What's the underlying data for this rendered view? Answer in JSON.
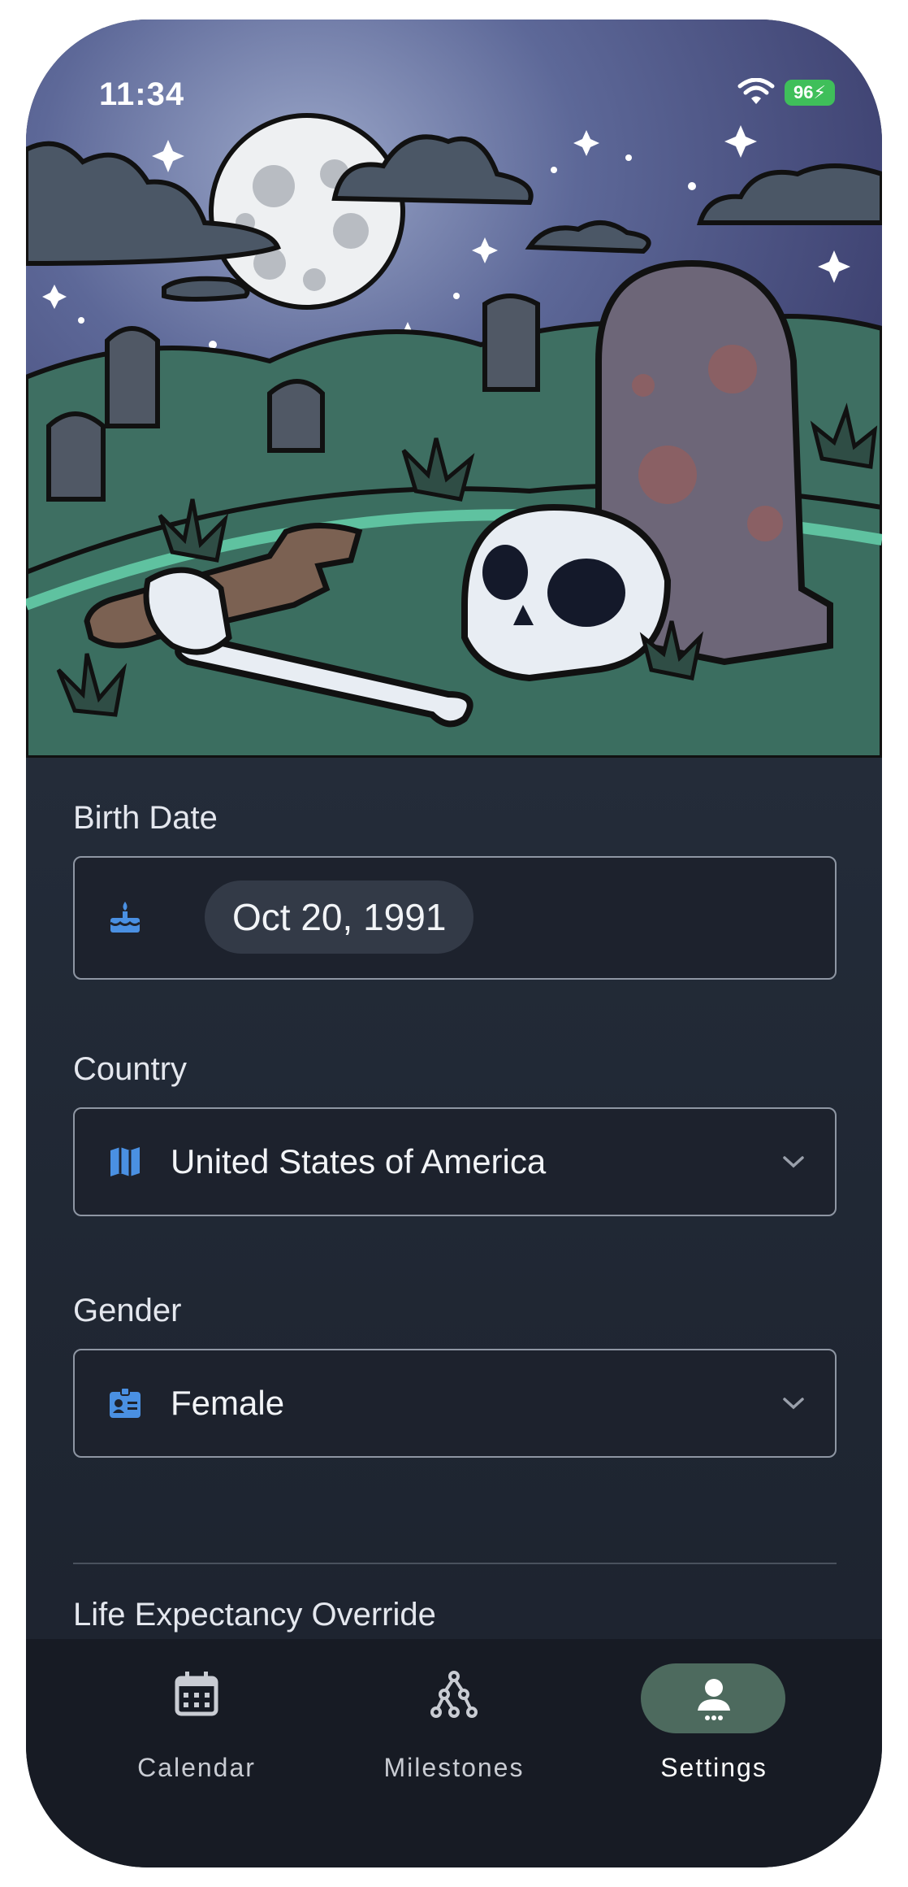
{
  "status": {
    "time": "11:34",
    "battery": "96"
  },
  "form": {
    "birth_date": {
      "label": "Birth Date",
      "value": "Oct 20, 1991"
    },
    "country": {
      "label": "Country",
      "value": "United States of America"
    },
    "gender": {
      "label": "Gender",
      "value": "Female"
    },
    "override_label": "Life Expectancy Override"
  },
  "nav": {
    "items": [
      {
        "label": "Calendar",
        "icon": "calendar-icon"
      },
      {
        "label": "Milestones",
        "icon": "milestones-icon"
      },
      {
        "label": "Settings",
        "icon": "settings-person-icon",
        "active": true
      }
    ]
  },
  "colors": {
    "accent": "#4a90e2",
    "active_tab": "#4d6a5e",
    "background": "#232a36"
  }
}
